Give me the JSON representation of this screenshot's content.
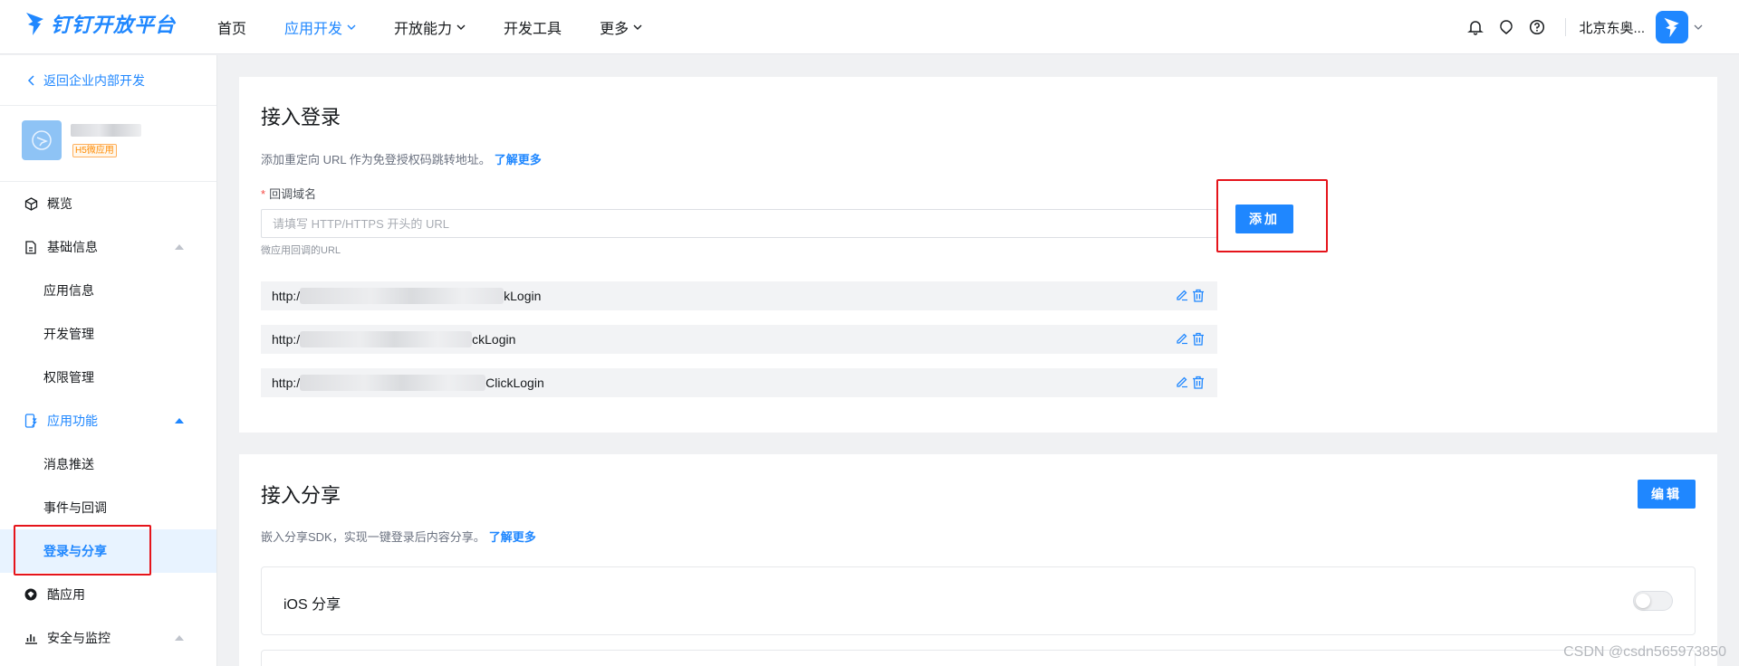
{
  "header": {
    "logo_text": "钉钉开放平台",
    "nav": [
      {
        "label": "首页",
        "active": false,
        "has_dropdown": false
      },
      {
        "label": "应用开发",
        "active": true,
        "has_dropdown": true
      },
      {
        "label": "开放能力",
        "active": false,
        "has_dropdown": true
      },
      {
        "label": "开发工具",
        "active": false,
        "has_dropdown": false
      },
      {
        "label": "更多",
        "active": false,
        "has_dropdown": true
      }
    ],
    "org_name": "北京东奥...",
    "icons": [
      "bell-icon",
      "tips-icon",
      "help-icon"
    ]
  },
  "sidebar": {
    "back_label": "返回企业内部开发",
    "app_badge": "H5微应用",
    "items": [
      {
        "label": "概览",
        "icon": "overview-icon",
        "type": "menu"
      },
      {
        "label": "基础信息",
        "icon": "doc-icon",
        "type": "menu",
        "expanded": true
      },
      {
        "label": "应用信息",
        "type": "sub"
      },
      {
        "label": "开发管理",
        "type": "sub"
      },
      {
        "label": "权限管理",
        "type": "sub"
      },
      {
        "label": "应用功能",
        "icon": "app-func-icon",
        "type": "menu",
        "expanded": true
      },
      {
        "label": "消息推送",
        "type": "sub"
      },
      {
        "label": "事件与回调",
        "type": "sub"
      },
      {
        "label": "登录与分享",
        "type": "sub",
        "active": true
      },
      {
        "label": "酷应用",
        "icon": "cool-app-icon",
        "type": "menu"
      },
      {
        "label": "安全与监控",
        "icon": "chart-icon",
        "type": "menu",
        "expanded": true
      }
    ]
  },
  "login_card": {
    "title": "接入登录",
    "desc": "添加重定向 URL 作为免登授权码跳转地址。",
    "learn_more": "了解更多",
    "field_label": "回调域名",
    "required_mark": "*",
    "input_placeholder": "请填写 HTTP/HTTPS 开头的 URL",
    "input_value": "",
    "hint": "微应用回调的URL",
    "add_button": "添加",
    "urls": [
      {
        "prefix": "http:/",
        "suffix": "kLogin"
      },
      {
        "prefix": "http:/",
        "suffix": "ckLogin"
      },
      {
        "prefix": "http:/",
        "suffix": "ClickLogin"
      }
    ]
  },
  "share_card": {
    "title": "接入分享",
    "desc": "嵌入分享SDK，实现一键登录后内容分享。",
    "learn_more": "了解更多",
    "edit_button": "编辑",
    "ios_label": "iOS 分享",
    "ios_enabled": false
  },
  "watermark": "CSDN @csdn565973850",
  "colors": {
    "accent": "#1f87ff",
    "highlight_box": "#e5141b",
    "page_bg": "#f0f1f3"
  }
}
